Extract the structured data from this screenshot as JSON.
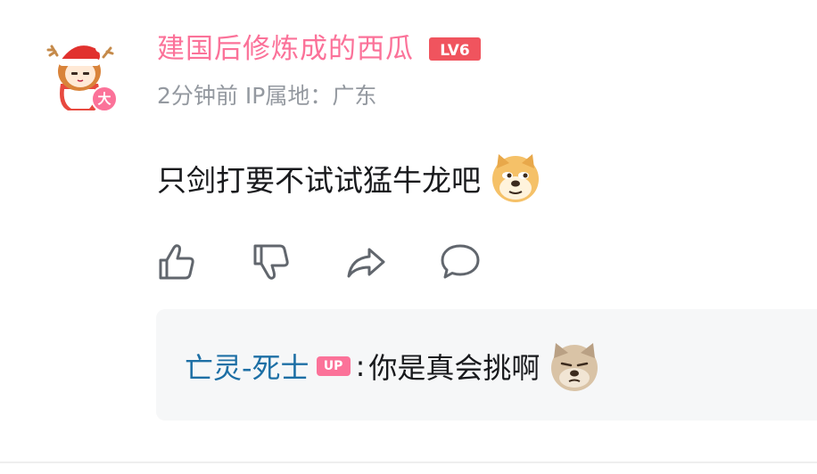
{
  "comment": {
    "username": "建国后修炼成的西瓜",
    "level": "LV6",
    "avatar_badge": "大",
    "time": "2分钟前",
    "ip_location": "IP属地：广东",
    "text": "只剑打要不试试猛牛龙吧",
    "emoji": "doge-emoji"
  },
  "actions": [
    {
      "name": "like",
      "icon": "thumbs-up-icon"
    },
    {
      "name": "dislike",
      "icon": "thumbs-down-icon"
    },
    {
      "name": "share",
      "icon": "share-icon"
    },
    {
      "name": "reply",
      "icon": "comment-icon"
    }
  ],
  "reply": {
    "username": "亡灵-死士",
    "up_badge": "UP",
    "colon": ":",
    "text": "你是真会挑啊",
    "emoji": "tired-doge-emoji"
  },
  "colors": {
    "brand_pink": "#fb7299",
    "reply_name": "#1d6fa5",
    "meta_gray": "#9499a0",
    "text": "#18191c",
    "reply_bg": "#f6f7f8"
  }
}
